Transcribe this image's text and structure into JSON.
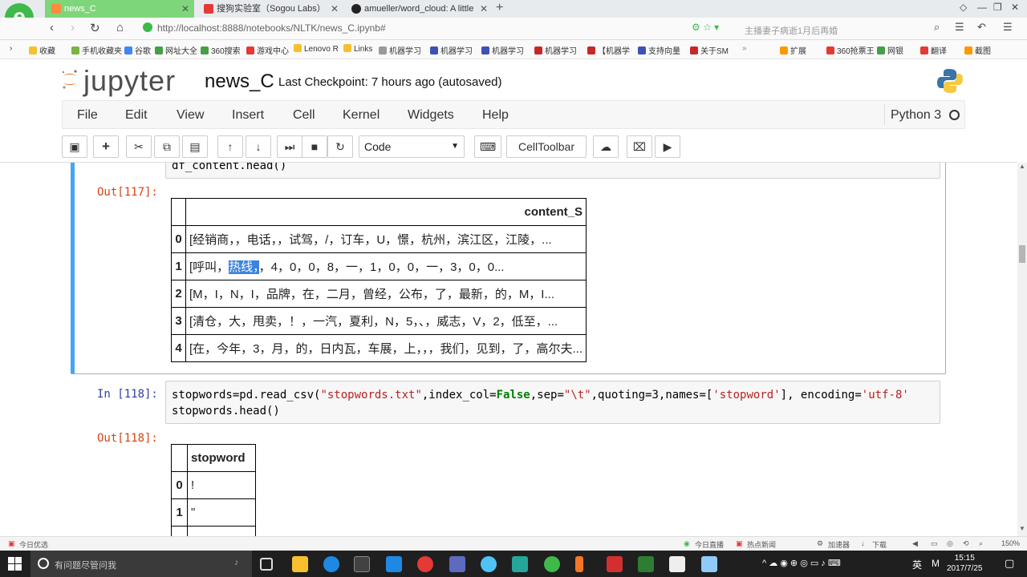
{
  "browser": {
    "tabs": [
      {
        "label": "news_C",
        "active": true
      },
      {
        "label": "搜狗实验室（Sogou Labs）",
        "active": false
      },
      {
        "label": "amueller/word_cloud: A little",
        "active": false
      }
    ],
    "url": "http://localhost:8888/notebooks/NLTK/news_C.ipynb#",
    "search_hint": "主播妻子病逝1月后再婚",
    "bookmarks": [
      "收藏",
      "手机收藏夹",
      "谷歌",
      "网址大全",
      "360搜索",
      "游戏中心",
      "Lenovo R",
      "Links",
      "机器学习",
      "机器学习",
      "机器学习",
      "机器学习",
      "【机器学",
      "支持向量",
      "关于SM",
      "扩展",
      "360抢票王",
      "网银",
      "翻译",
      "截图"
    ]
  },
  "jupyter": {
    "logo_text": "jupyter",
    "notebook_name": "news_C",
    "checkpoint": "Last Checkpoint: 7 hours ago (autosaved)",
    "menu": [
      "File",
      "Edit",
      "View",
      "Insert",
      "Cell",
      "Kernel",
      "Widgets",
      "Help"
    ],
    "kernel": "Python 3",
    "toolbar": {
      "cell_type": "Code",
      "celltoolbar": "CellToolbar"
    }
  },
  "cells": {
    "prev_code_tail": "df_content.head()",
    "out117": {
      "prompt": "Out[117]:",
      "column": "content_S",
      "rows": [
        {
          "idx": "0",
          "value": "[经销商，，电话，，试驾，/，订车，U，憬，杭州，滨江区，江陵，..."
        },
        {
          "idx": "1",
          "value_pre": "[呼叫，",
          "value_hl": "热线，",
          "value_post": "，4，0，0，8，一，1，0，0，一，3，0，0..."
        },
        {
          "idx": "2",
          "value": "[M，I，N，I，品牌，在，二月，曾经，公布，了，最新，的，M，I..."
        },
        {
          "idx": "3",
          "value": "[清仓，大，甩卖，！，一汽，夏利，N，5，、，威志，V，2，低至，..."
        },
        {
          "idx": "4",
          "value": "[在，今年，3，月，的，日内瓦，车展，上，，，我们，见到，了，高尔夫..."
        }
      ]
    },
    "in118": {
      "prompt": "In [118]:",
      "line1_a": "stopwords=pd.read_csv(",
      "line1_s1": "\"stopwords.txt\"",
      "line1_b": ",index_col=",
      "line1_kw": "False",
      "line1_c": ",sep=",
      "line1_s2": "\"\\t\"",
      "line1_d": ",quoting=3,names=[",
      "line1_s3": "'stopword'",
      "line1_e": "], encoding=",
      "line1_s4": "'utf-8'",
      "line2": "stopwords.head()"
    },
    "out118": {
      "prompt": "Out[118]:",
      "column": "stopword",
      "rows": [
        {
          "idx": "0",
          "value": "!"
        },
        {
          "idx": "1",
          "value": "\""
        }
      ]
    }
  },
  "statusbar": {
    "left": "今日优选",
    "items": [
      "今日直播",
      "热点新闻",
      "加速器",
      "下载",
      "150%"
    ]
  },
  "taskbar": {
    "search_placeholder": "有问题尽管问我",
    "ime": "英",
    "ime_mode": "M",
    "time": "15:15",
    "date": "2017/7/25"
  }
}
